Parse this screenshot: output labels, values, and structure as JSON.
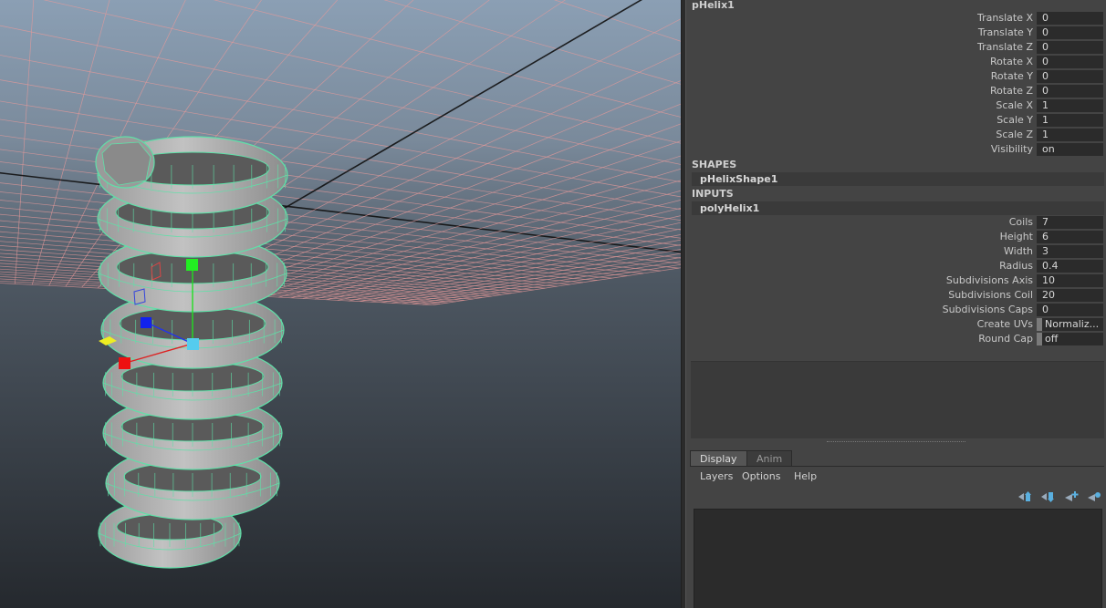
{
  "viewport": {
    "grid_line_color": "#e79a9a",
    "wire_color": "#5fe0a8",
    "background_top": "#8b9fb4",
    "background_bottom": "#1e2226"
  },
  "channel_box": {
    "object_name": "pHelix1",
    "transform_attrs": [
      {
        "label": "Translate X",
        "value": "0"
      },
      {
        "label": "Translate Y",
        "value": "0"
      },
      {
        "label": "Translate Z",
        "value": "0"
      },
      {
        "label": "Rotate X",
        "value": "0"
      },
      {
        "label": "Rotate Y",
        "value": "0"
      },
      {
        "label": "Rotate Z",
        "value": "0"
      },
      {
        "label": "Scale X",
        "value": "1"
      },
      {
        "label": "Scale Y",
        "value": "1"
      },
      {
        "label": "Scale Z",
        "value": "1"
      },
      {
        "label": "Visibility",
        "value": "on"
      }
    ],
    "shapes_header": "SHAPES",
    "shape_node": "pHelixShape1",
    "inputs_header": "INPUTS",
    "input_node": "polyHelix1",
    "input_attrs": [
      {
        "label": "Coils",
        "value": "7"
      },
      {
        "label": "Height",
        "value": "6"
      },
      {
        "label": "Width",
        "value": "3"
      },
      {
        "label": "Radius",
        "value": "0.4"
      },
      {
        "label": "Subdivisions Axis",
        "value": "10"
      },
      {
        "label": "Subdivisions Coil",
        "value": "20"
      },
      {
        "label": "Subdivisions Caps",
        "value": "0"
      },
      {
        "label": "Create UVs",
        "value": "Normaliz..."
      },
      {
        "label": "Round Cap",
        "value": "off"
      }
    ]
  },
  "layer_editor": {
    "tabs": [
      {
        "label": "Display"
      },
      {
        "label": "Anim"
      }
    ],
    "menus": [
      {
        "label": "Layers"
      },
      {
        "label": "Options"
      },
      {
        "label": "Help"
      }
    ],
    "tool_icons": [
      "move-layer-up-icon",
      "move-layer-down-icon",
      "new-layer-icon",
      "new-layer-from-selection-icon"
    ]
  }
}
